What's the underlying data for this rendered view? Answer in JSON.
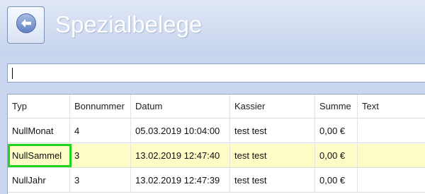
{
  "header": {
    "title": "Spezialbelege",
    "back_icon": "back-arrow-icon"
  },
  "search": {
    "value": "",
    "placeholder": ""
  },
  "table": {
    "columns": [
      "Typ",
      "Bonnummer",
      "Datum",
      "Kassier",
      "Summe",
      "Text"
    ],
    "rows": [
      {
        "typ": "NullMonat",
        "bonnummer": "4",
        "datum": "05.03.2019 10:04:00",
        "kassier": "test  test",
        "summe": "0,00 €",
        "text": ""
      },
      {
        "typ": "NullSammel",
        "bonnummer": "3",
        "datum": "13.02.2019 12:47:40",
        "kassier": "test  test",
        "summe": "0,00 €",
        "text": ""
      },
      {
        "typ": "NullJahr",
        "bonnummer": "3",
        "datum": "13.02.2019 12:47:39",
        "kassier": "test  test",
        "summe": "0,00 €",
        "text": ""
      }
    ],
    "selected_row": 1
  },
  "colors": {
    "selected_row": "#fdfcc6",
    "highlight_box": "#1fd31f",
    "header_bg": "#c9d6ee"
  }
}
